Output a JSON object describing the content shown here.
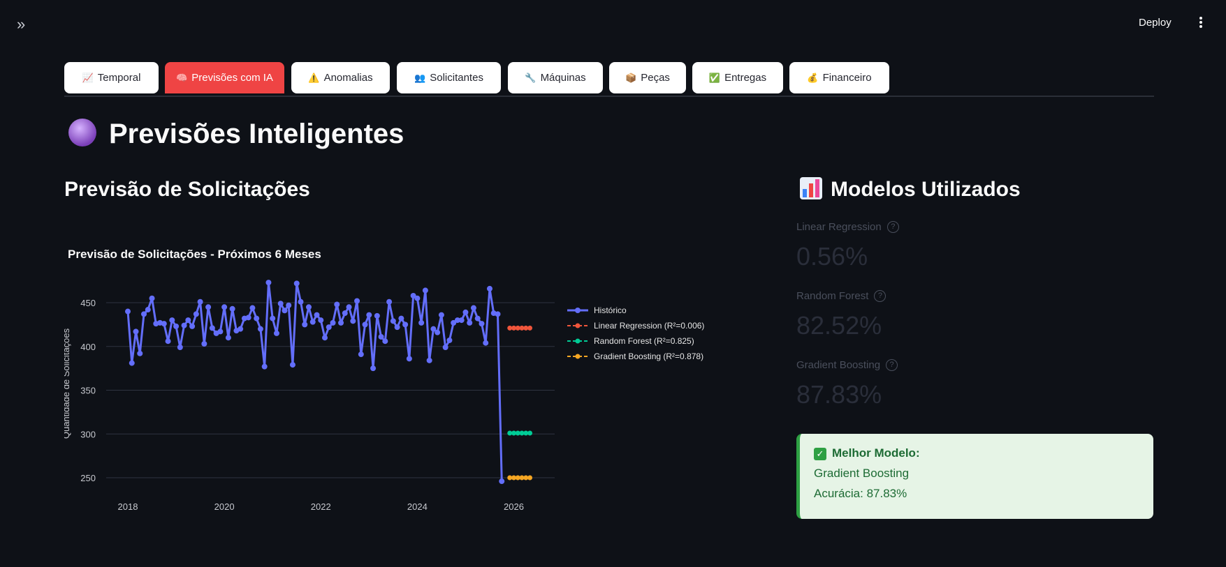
{
  "app": {
    "deploy_label": "Deploy"
  },
  "tabs": [
    {
      "label": "Temporal",
      "icon": "📈"
    },
    {
      "label": "Previsões com IA",
      "icon": "🧠"
    },
    {
      "label": "Anomalias",
      "icon": "⚠️"
    },
    {
      "label": "Solicitantes",
      "icon": "👥"
    },
    {
      "label": "Máquinas",
      "icon": "🔧"
    },
    {
      "label": "Peças",
      "icon": "📦"
    },
    {
      "label": "Entregas",
      "icon": "✅"
    },
    {
      "label": "Financeiro",
      "icon": "💰"
    }
  ],
  "active_tab": "Previsões com IA",
  "page_title": "Previsões Inteligentes",
  "forecast_heading": "Previsão de Solicitações",
  "models_heading": "Modelos Utilizados",
  "metrics": [
    {
      "label": "Linear Regression",
      "value": "0.56%"
    },
    {
      "label": "Random Forest",
      "value": "82.52%"
    },
    {
      "label": "Gradient Boosting",
      "value": "87.83%"
    }
  ],
  "best_model": {
    "title": "Melhor Modelo:",
    "name": "Gradient Boosting",
    "accuracy": "Acurácia: 87.83%"
  },
  "colors": {
    "historico": "#636efa",
    "linear": "#ef553b",
    "random_forest": "#00cc96",
    "gradient": "#f5a623",
    "active_tab": "#ef4444"
  },
  "chart_data": {
    "type": "line",
    "title": "Previsão de Solicitações - Próximos 6 Meses",
    "ylabel": "Quantidade de Solicitações",
    "xlabel": "",
    "ylim": [
      240,
      490
    ],
    "x_ticks": [
      "2018",
      "2020",
      "2022",
      "2024",
      "2026"
    ],
    "yticks": [
      250,
      300,
      350,
      400,
      450
    ],
    "grid": true,
    "legend_position": "right",
    "series": [
      {
        "name": "Histórico",
        "x_start": "2018-01",
        "values": [
          440,
          381,
          417,
          392,
          437,
          442,
          455,
          426,
          427,
          426,
          406,
          430,
          423,
          399,
          424,
          430,
          423,
          437,
          451,
          403,
          445,
          421,
          415,
          417,
          445,
          410,
          443,
          418,
          420,
          432,
          433,
          444,
          432,
          420,
          377,
          473,
          432,
          415,
          449,
          441,
          447,
          379,
          472,
          451,
          425,
          445,
          428,
          436,
          430,
          410,
          422,
          427,
          448,
          427,
          438,
          445,
          429,
          452,
          391,
          425,
          436,
          375,
          435,
          411,
          406,
          451,
          429,
          422,
          432,
          425,
          386,
          458,
          455,
          427,
          464,
          384,
          420,
          416,
          436,
          399,
          407,
          427,
          430,
          430,
          439,
          427,
          444,
          432,
          426,
          404,
          466,
          438,
          437,
          246
        ]
      },
      {
        "name": "Linear Regression (R²=0.006)",
        "values": [
          421,
          421,
          421,
          421,
          421,
          421
        ]
      },
      {
        "name": "Random Forest (R²=0.825)",
        "values": [
          301,
          301,
          301,
          301,
          301,
          301
        ]
      },
      {
        "name": "Gradient Boosting (R²=0.878)",
        "values": [
          250,
          250,
          250,
          250,
          250,
          250
        ]
      }
    ]
  }
}
